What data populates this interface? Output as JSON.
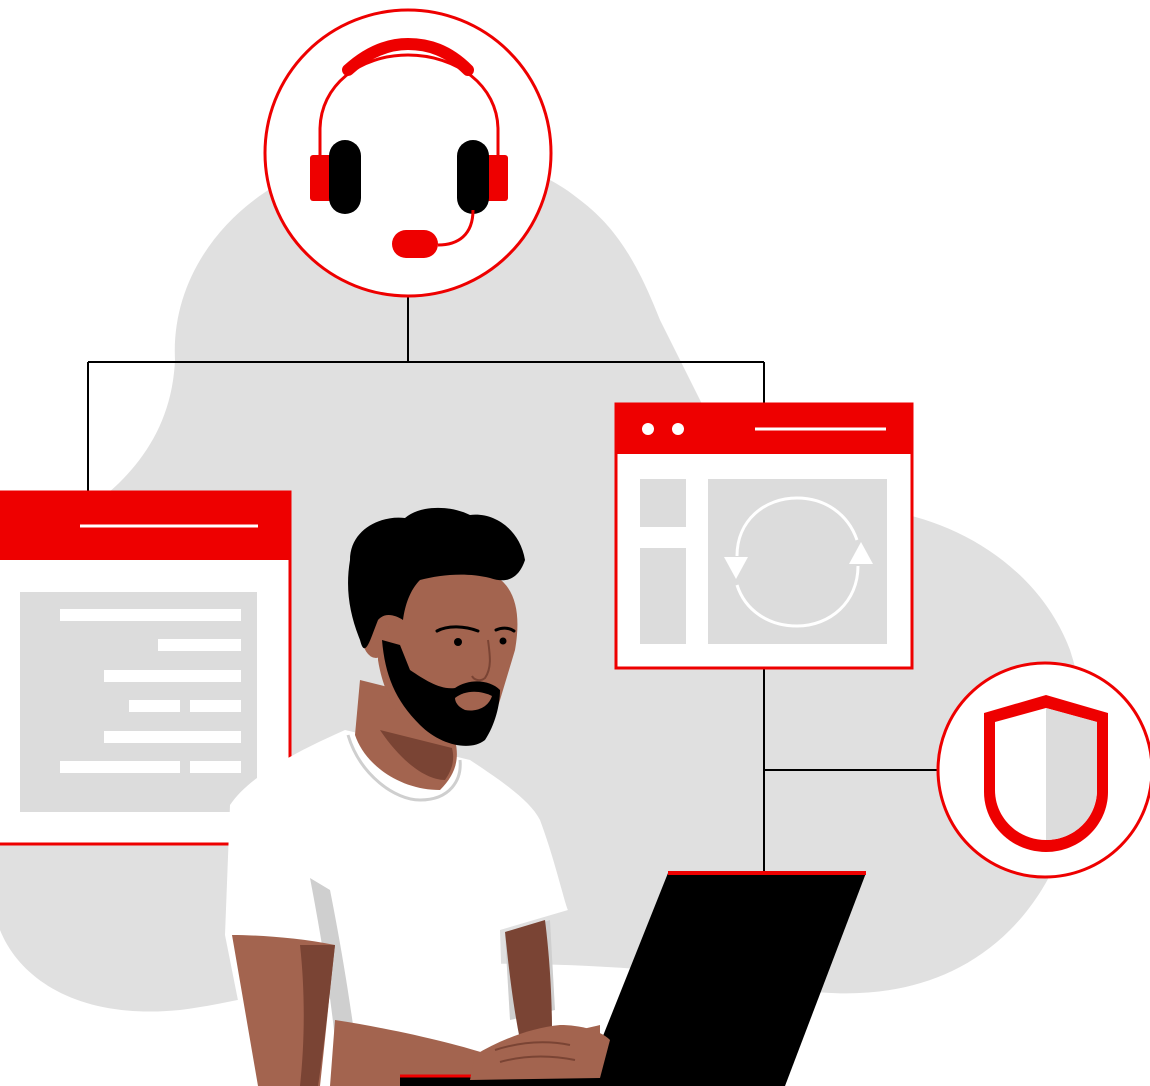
{
  "illustration": {
    "colors": {
      "brand_red": "#ee0000",
      "cloud_gray": "#e0e0e0",
      "panel_gray": "#dcdcdc",
      "black": "#000000",
      "white": "#ffffff",
      "skin": "#a3644f",
      "skin_shadow": "#7a4434",
      "shirt_shadow": "#cfcfcf"
    },
    "icons": {
      "headset": "headset-icon",
      "document_window": "document-window-icon",
      "sync_window": "sync-window-icon",
      "shield": "shield-icon",
      "laptop": "laptop-icon",
      "person": "person-at-laptop"
    }
  }
}
